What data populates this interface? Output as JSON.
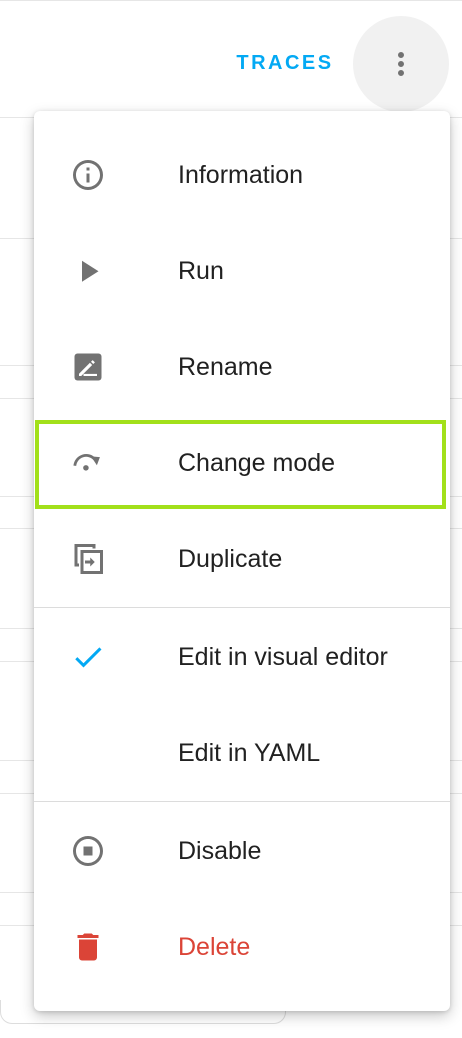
{
  "toolbar": {
    "traces_label": "TRACES",
    "overflow_icon": "dots-vertical-icon"
  },
  "menu": {
    "items": [
      {
        "label": "Information",
        "icon": "information-outline-icon"
      },
      {
        "label": "Run",
        "icon": "play-icon"
      },
      {
        "label": "Rename",
        "icon": "rename-box-icon"
      },
      {
        "label": "Change mode",
        "icon": "debug-step-over-icon"
      },
      {
        "label": "Duplicate",
        "icon": "content-duplicate-icon"
      },
      {
        "label": "Edit in visual editor",
        "icon": "check-icon"
      },
      {
        "label": "Edit in YAML",
        "icon": ""
      },
      {
        "label": "Disable",
        "icon": "stop-circle-outline-icon"
      },
      {
        "label": "Delete",
        "icon": "delete-icon"
      }
    ],
    "highlighted_item": "Change mode"
  },
  "colors": {
    "accent": "#03a9f4",
    "icon": "#727272",
    "text": "#212121",
    "danger": "#db4437",
    "highlight_border": "#a2e01a"
  }
}
